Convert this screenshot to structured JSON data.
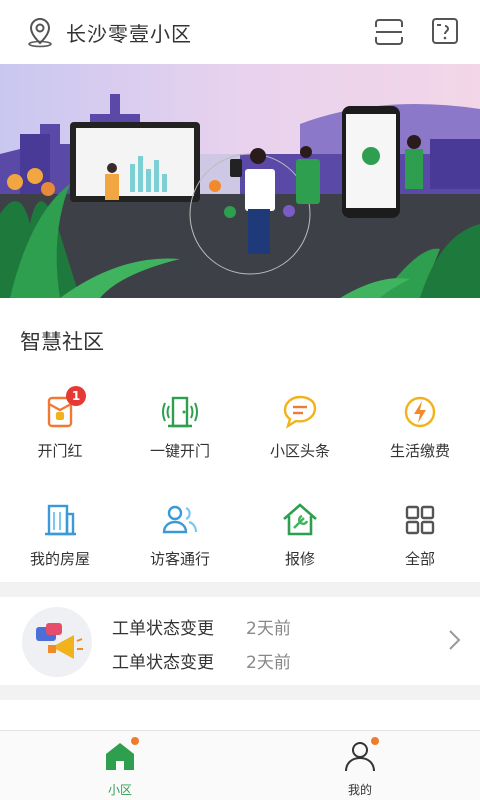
{
  "header": {
    "location": "长沙零壹小区",
    "icons": [
      "location-pin-icon",
      "scan-icon",
      "help-icon"
    ]
  },
  "banner": {
    "description_icons": [
      "smart-city-illustration"
    ]
  },
  "smart_community": {
    "title": "智慧社区",
    "items": [
      {
        "label": "开门红",
        "icon": "red-envelope-icon",
        "badge": "1",
        "color": "#f27935"
      },
      {
        "label": "一键开门",
        "icon": "door-open-icon",
        "color": "#2e9e4f"
      },
      {
        "label": "小区头条",
        "icon": "chat-bubble-icon",
        "color": "#f2b21b"
      },
      {
        "label": "生活缴费",
        "icon": "lightning-icon",
        "color": "#f28a2a"
      },
      {
        "label": "我的房屋",
        "icon": "building-icon",
        "color": "#3a9ad9"
      },
      {
        "label": "访客通行",
        "icon": "visitor-icon",
        "color": "#3a9ad9"
      },
      {
        "label": "报修",
        "icon": "repair-house-icon",
        "color": "#2e9e4f"
      },
      {
        "label": "全部",
        "icon": "grid-icon",
        "color": "#555555"
      }
    ]
  },
  "notices": [
    {
      "text": "工单状态变更",
      "time": "2天前"
    },
    {
      "text": "工单状态变更",
      "time": "2天前"
    }
  ],
  "tabs": [
    {
      "label": "小区",
      "active": true,
      "color": "#2e9e4f"
    },
    {
      "label": "我的",
      "active": false,
      "color": "#333333"
    }
  ],
  "colors": {
    "primary": "#2e9e4f",
    "badge": "#e53935",
    "dot": "#f07b2a"
  }
}
